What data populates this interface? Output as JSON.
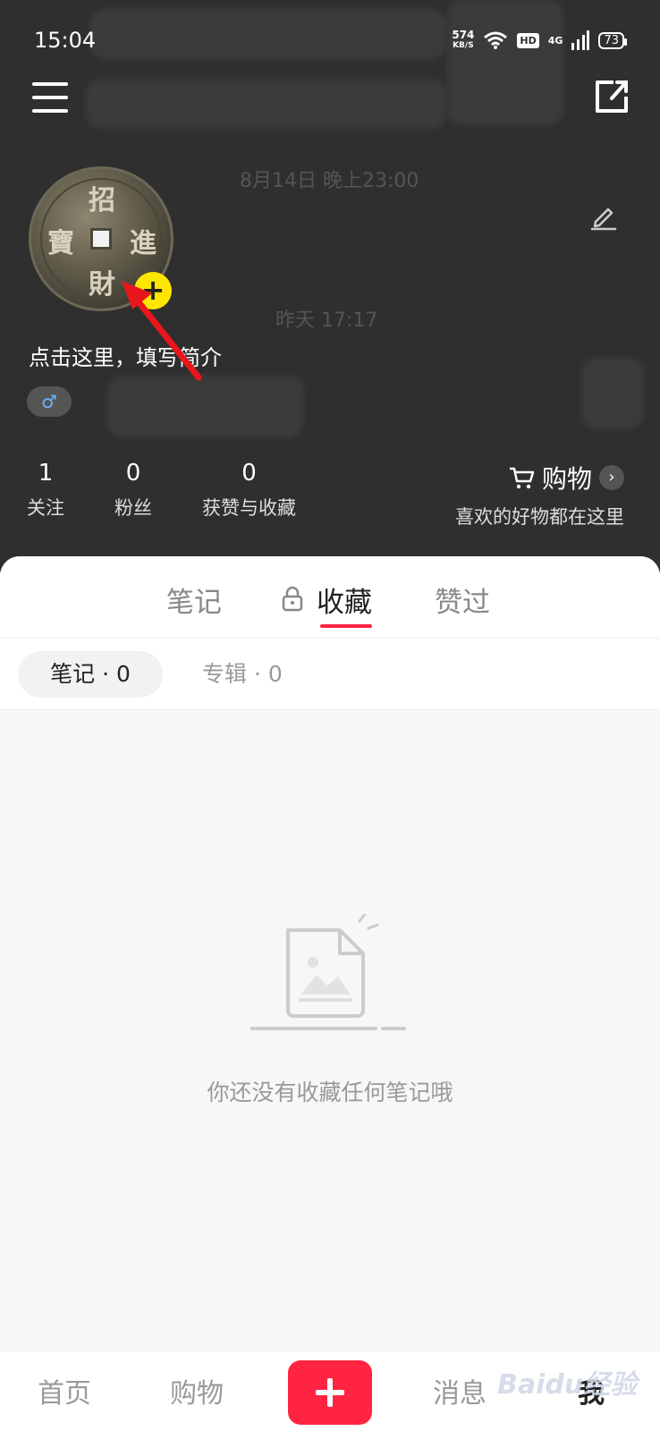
{
  "status_bar": {
    "time": "15:04",
    "net_speed": "574",
    "net_unit": "KB/S",
    "hd": "HD",
    "network": "4G",
    "battery": "73"
  },
  "profile": {
    "coin_chars": {
      "top": "招",
      "left": "寶",
      "right": "進",
      "bottom": "財"
    },
    "bio_placeholder": "点击这里，填写简介",
    "gender_symbol": "♂",
    "stats": [
      {
        "value": "1",
        "label": "关注"
      },
      {
        "value": "0",
        "label": "粉丝"
      },
      {
        "value": "0",
        "label": "获赞与收藏"
      }
    ],
    "shop": {
      "title": "购物",
      "subtitle": "喜欢的好物都在这里"
    }
  },
  "background_text": {
    "date1": "8月14日 晚上23:00",
    "date2": "昨天 17:17"
  },
  "tabs": [
    {
      "label": "笔记"
    },
    {
      "label": "收藏"
    },
    {
      "label": "赞过"
    }
  ],
  "subtabs": [
    {
      "label": "笔记 · 0"
    },
    {
      "label": "专辑 · 0"
    }
  ],
  "empty_state": {
    "message": "你还没有收藏任何笔记哦"
  },
  "bottom_nav": {
    "items": [
      "首页",
      "购物",
      "消息",
      "我"
    ]
  },
  "watermark": "Baidu经验",
  "colors": {
    "accent": "#ff2442",
    "avatar_badge": "#ffe600",
    "header_bg": "#2f2f2f",
    "arrow": "#e8161c"
  }
}
